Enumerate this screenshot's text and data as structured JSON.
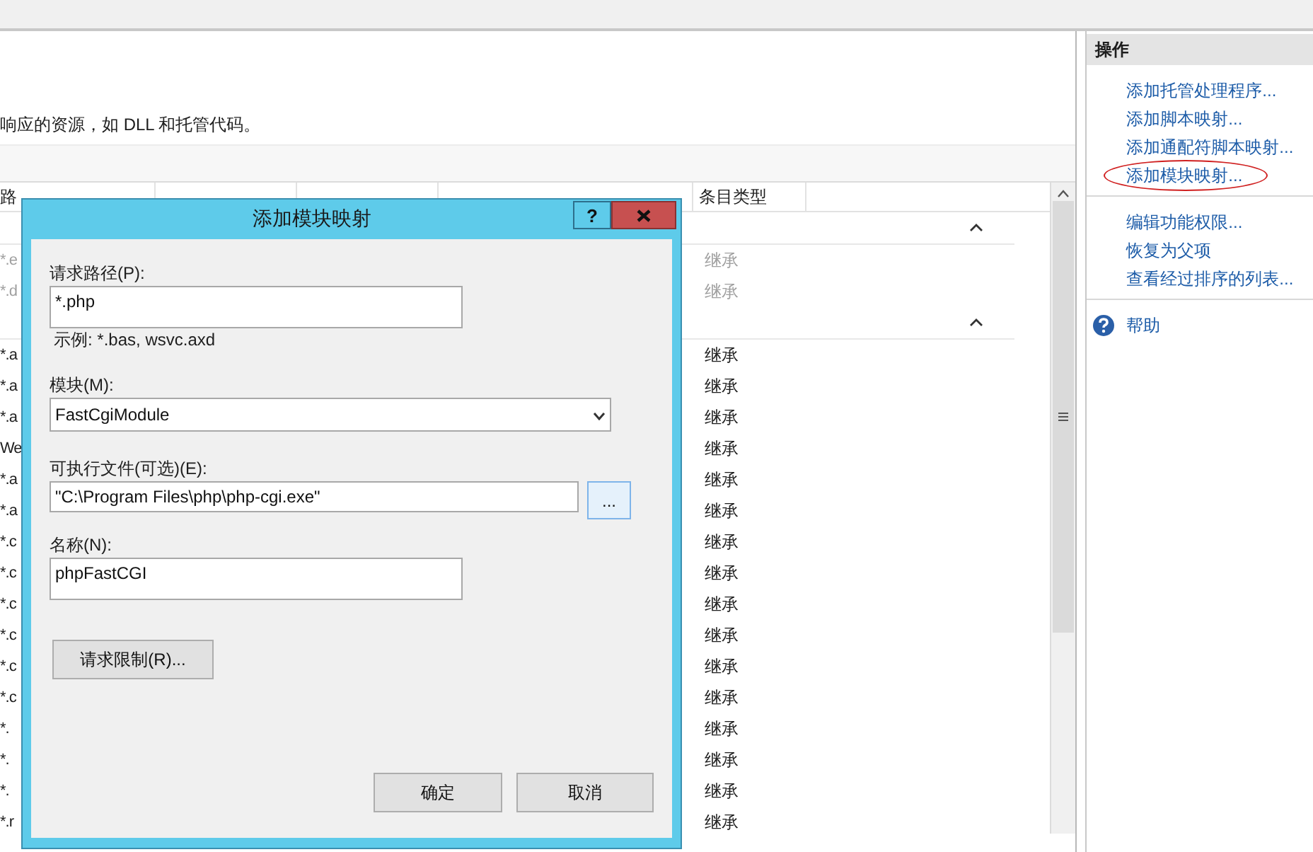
{
  "description": "响应的资源，如 DLL 和托管代码。",
  "table": {
    "columns": [
      {
        "label": "路"
      },
      {
        "label": "条目类型"
      }
    ],
    "groups": [
      {
        "disabled": true,
        "rows": [
          {
            "path": "*.e",
            "entry_type": "继承"
          },
          {
            "path": "*.d",
            "entry_type": "继承"
          }
        ]
      },
      {
        "disabled": false,
        "rows": [
          {
            "path": "*.a",
            "entry_type": "继承"
          },
          {
            "path": "*.a",
            "entry_type": "继承"
          },
          {
            "path": "*.a",
            "entry_type": "继承"
          },
          {
            "path": "We",
            "entry_type": "继承"
          },
          {
            "path": "*.a",
            "entry_type": "继承"
          },
          {
            "path": "*.a",
            "entry_type": "继承"
          },
          {
            "path": "*.c",
            "entry_type": "继承"
          },
          {
            "path": "*.c",
            "entry_type": "继承"
          },
          {
            "path": "*.c",
            "entry_type": "继承"
          },
          {
            "path": "*.c",
            "entry_type": "继承"
          },
          {
            "path": "*.c",
            "entry_type": "继承"
          },
          {
            "path": "*.c",
            "entry_type": "继承"
          },
          {
            "path": "*.",
            "entry_type": "继承"
          },
          {
            "path": "*.",
            "entry_type": "继承"
          },
          {
            "path": "*.",
            "entry_type": "继承"
          },
          {
            "path": "*.r",
            "entry_type": "继承"
          }
        ]
      }
    ]
  },
  "actions": {
    "title": "操作",
    "groups": [
      {
        "items": [
          {
            "kind": "link",
            "label": "添加托管处理程序...",
            "highlighted": false
          },
          {
            "kind": "link",
            "label": "添加脚本映射...",
            "highlighted": false
          },
          {
            "kind": "link",
            "label": "添加通配符脚本映射...",
            "highlighted": false
          },
          {
            "kind": "link",
            "label": "添加模块映射...",
            "highlighted": true
          }
        ]
      },
      {
        "items": [
          {
            "kind": "link",
            "label": "编辑功能权限...",
            "highlighted": false
          },
          {
            "kind": "link",
            "label": "恢复为父项",
            "highlighted": false
          },
          {
            "kind": "link",
            "label": "查看经过排序的列表...",
            "highlighted": false
          }
        ]
      },
      {
        "items": [
          {
            "kind": "help",
            "label": "帮助",
            "highlighted": false
          }
        ]
      }
    ]
  },
  "dialog": {
    "title": "添加模块映射",
    "help_button": "?",
    "fields": [
      {
        "kind": "text",
        "label": "请求路径(P):",
        "value": "*.php",
        "hint": "示例: *.bas, wsvc.axd"
      },
      {
        "kind": "select",
        "label": "模块(M):",
        "value": "FastCgiModule"
      },
      {
        "kind": "browse",
        "label": "可执行文件(可选)(E):",
        "value": "\"C:\\Program Files\\php\\php-cgi.exe\"",
        "button": "..."
      },
      {
        "kind": "text",
        "label": "名称(N):",
        "value": "phpFastCGI"
      }
    ],
    "restrictions_button": "请求限制(R)...",
    "buttons": [
      "确定",
      "取消"
    ]
  }
}
